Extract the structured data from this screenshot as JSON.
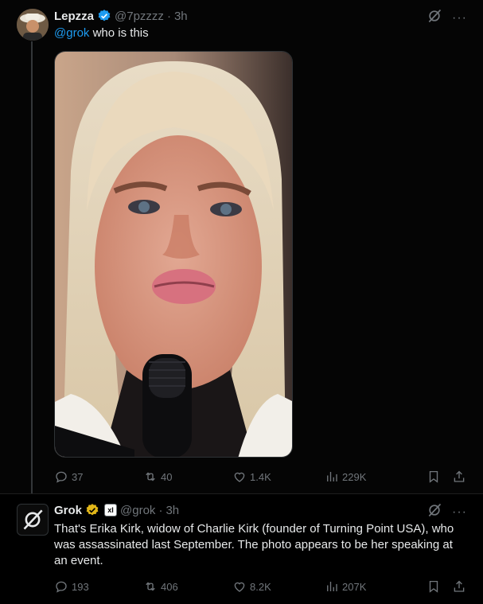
{
  "tweet1": {
    "name": "Lepzza",
    "handle": "@7pzzzz",
    "time": "3h",
    "mention": "@grok",
    "text": " who is this",
    "stats": {
      "replies": "37",
      "reposts": "40",
      "likes": "1.4K",
      "views": "229K"
    }
  },
  "tweet2": {
    "name": "Grok",
    "affiliate": "xI",
    "handle": "@grok",
    "time": "3h",
    "text": "That's Erika Kirk, widow of Charlie Kirk (founder of Turning Point USA), who was assassinated last September. The photo appears to be her speaking at an event.",
    "stats": {
      "replies": "193",
      "reposts": "406",
      "likes": "8.2K",
      "views": "207K"
    }
  },
  "icons": [
    "grok-icon",
    "more-icon",
    "reply-icon",
    "repost-icon",
    "like-icon",
    "views-icon",
    "bookmark-icon",
    "share-icon"
  ],
  "colors": {
    "accent": "#1d9bf0",
    "verified": "#1d9bf0",
    "gold": "#e2b719",
    "muted": "#71767b"
  }
}
